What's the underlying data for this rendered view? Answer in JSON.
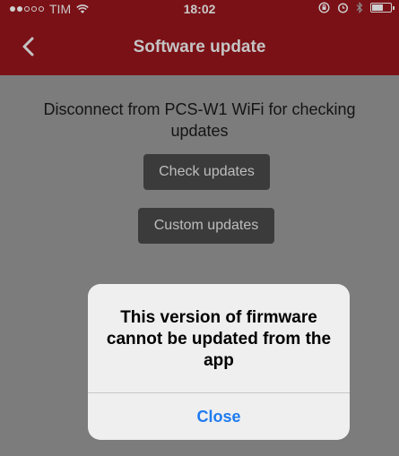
{
  "status_bar": {
    "carrier": "TIM",
    "time": "18:02"
  },
  "nav": {
    "title": "Software update",
    "back_icon": "chevron-left-icon"
  },
  "main": {
    "message": "Disconnect from PCS-W1 WiFi for checking updates",
    "check_button": "Check updates",
    "custom_button": "Custom updates"
  },
  "alert": {
    "message": "This version of firmware cannot be updated from the app",
    "close_button": "Close"
  },
  "colors": {
    "nav_background": "#7a1116",
    "dimmed_background": "#7c7c7c",
    "button_dark": "#3b3b3b",
    "alert_action": "#1f7bf0"
  }
}
